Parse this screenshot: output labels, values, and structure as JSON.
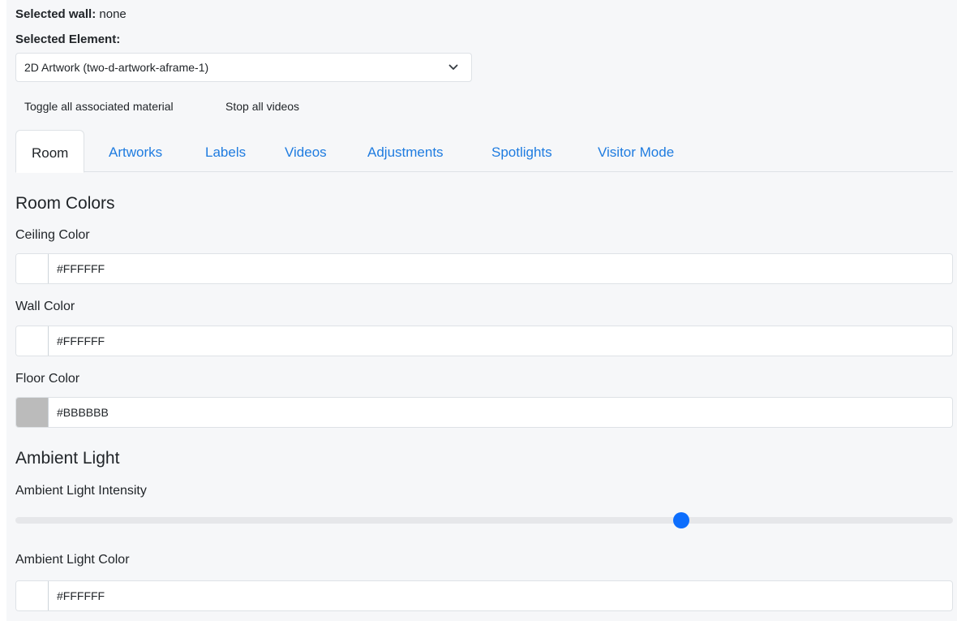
{
  "selected_wall": {
    "label": "Selected wall:",
    "value": "none"
  },
  "selected_element": {
    "label": "Selected Element:",
    "value": "2D Artwork (two-d-artwork-aframe-1)"
  },
  "actions": {
    "toggle_material": "Toggle all associated material",
    "stop_videos": "Stop all videos"
  },
  "tabs": [
    {
      "label": "Room",
      "active": true
    },
    {
      "label": "Artworks",
      "active": false
    },
    {
      "label": "Labels",
      "active": false
    },
    {
      "label": "Videos",
      "active": false
    },
    {
      "label": "Adjustments",
      "active": false
    },
    {
      "label": "Spotlights",
      "active": false
    },
    {
      "label": "Visitor Mode",
      "active": false
    }
  ],
  "room_colors": {
    "title": "Room Colors",
    "ceiling": {
      "label": "Ceiling Color",
      "value": "#FFFFFF",
      "swatch": "#ffffff"
    },
    "wall": {
      "label": "Wall Color",
      "value": "#FFFFFF",
      "swatch": "#ffffff"
    },
    "floor": {
      "label": "Floor Color",
      "value": "#BBBBBB",
      "swatch": "#bbbbbb"
    }
  },
  "ambient_light": {
    "title": "Ambient Light",
    "intensity_label": "Ambient Light Intensity",
    "intensity_fraction": 0.71,
    "color_label": "Ambient Light Color",
    "color_value": "#FFFFFF",
    "color_swatch": "#ffffff"
  },
  "colors": {
    "accent": "#0d6efd",
    "tab_link": "#1f7ce0",
    "panel_bg": "#f6f7f9"
  },
  "icons": {
    "select_caret": "chevron-down-icon"
  }
}
